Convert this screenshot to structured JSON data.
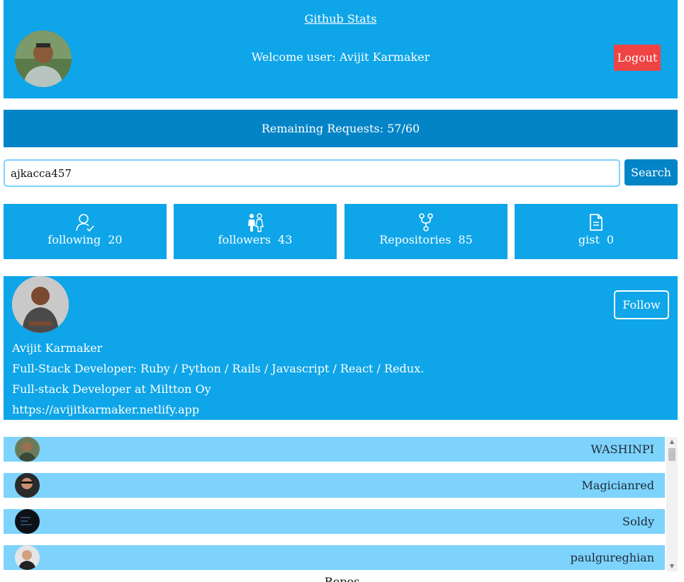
{
  "header": {
    "title": "Github Stats",
    "welcome": "Welcome user: Avijit Karmaker",
    "logout_label": "Logout"
  },
  "remaining": "Remaining Requests: 57/60",
  "search": {
    "value": "ajkacca457",
    "button_label": "Search"
  },
  "stats": [
    {
      "label": "following",
      "count": "20",
      "icon": "user-check-icon"
    },
    {
      "label": "followers",
      "count": "43",
      "icon": "people-icon"
    },
    {
      "label": "Repositories",
      "count": "85",
      "icon": "git-fork-icon"
    },
    {
      "label": "gist",
      "count": "0",
      "icon": "file-icon"
    }
  ],
  "profile": {
    "name": "Avijit Karmaker",
    "bio": "Full-Stack Developer: Ruby / Python / Rails / Javascript / React / Redux.",
    "company": "Full-stack Developer at Miltton Oy",
    "blog": "https://avijitkarmaker.netlify.app",
    "follow_label": "Follow"
  },
  "followers_list": [
    {
      "name": "WASHINPI"
    },
    {
      "name": "Magicianred"
    },
    {
      "name": "Soldy"
    },
    {
      "name": "paulgureghian"
    }
  ],
  "repos_label": "Repos",
  "colors": {
    "primary": "#0ea5e9",
    "dark": "#0284c7",
    "light_row": "#7dd3fc",
    "logout": "#ef4444"
  }
}
